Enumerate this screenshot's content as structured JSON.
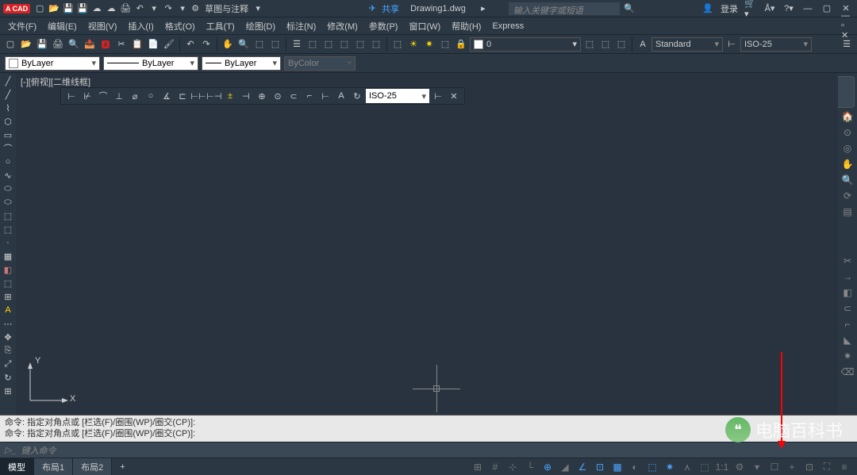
{
  "title": {
    "app_badge": "A CAD",
    "filename": "Drawing1.dwg",
    "sketch_label": "草图与注释",
    "share_label": "共享",
    "search_placeholder": "输入关键字或短语",
    "login_label": "登录"
  },
  "menus": [
    "文件(F)",
    "编辑(E)",
    "视图(V)",
    "插入(I)",
    "格式(O)",
    "工具(T)",
    "绘图(D)",
    "标注(N)",
    "修改(M)",
    "参数(P)",
    "窗口(W)",
    "帮助(H)",
    "Express"
  ],
  "layer_panel": {
    "layer_name": "0",
    "text_style": "Standard",
    "dim_style": "ISO-25"
  },
  "props": {
    "color": "ByLayer",
    "linetype": "ByLayer",
    "lineweight": "ByLayer",
    "plot_style": "ByColor"
  },
  "viewport": {
    "label": "[-][俯视][二维线框]"
  },
  "dim_toolbar": {
    "style": "ISO-25"
  },
  "ucs": {
    "x": "X",
    "y": "Y"
  },
  "cmdline": {
    "line1": "命令: 指定对角点或 [栏选(F)/圈围(WP)/圈交(CP)]:",
    "line2": "命令: 指定对角点或 [栏选(F)/圈围(WP)/圈交(CP)]:",
    "prompt_label": "键入命令"
  },
  "layout_tabs": [
    "模型",
    "布局1",
    "布局2"
  ],
  "status_scale": "1:1",
  "watermark": "电脑百科书"
}
